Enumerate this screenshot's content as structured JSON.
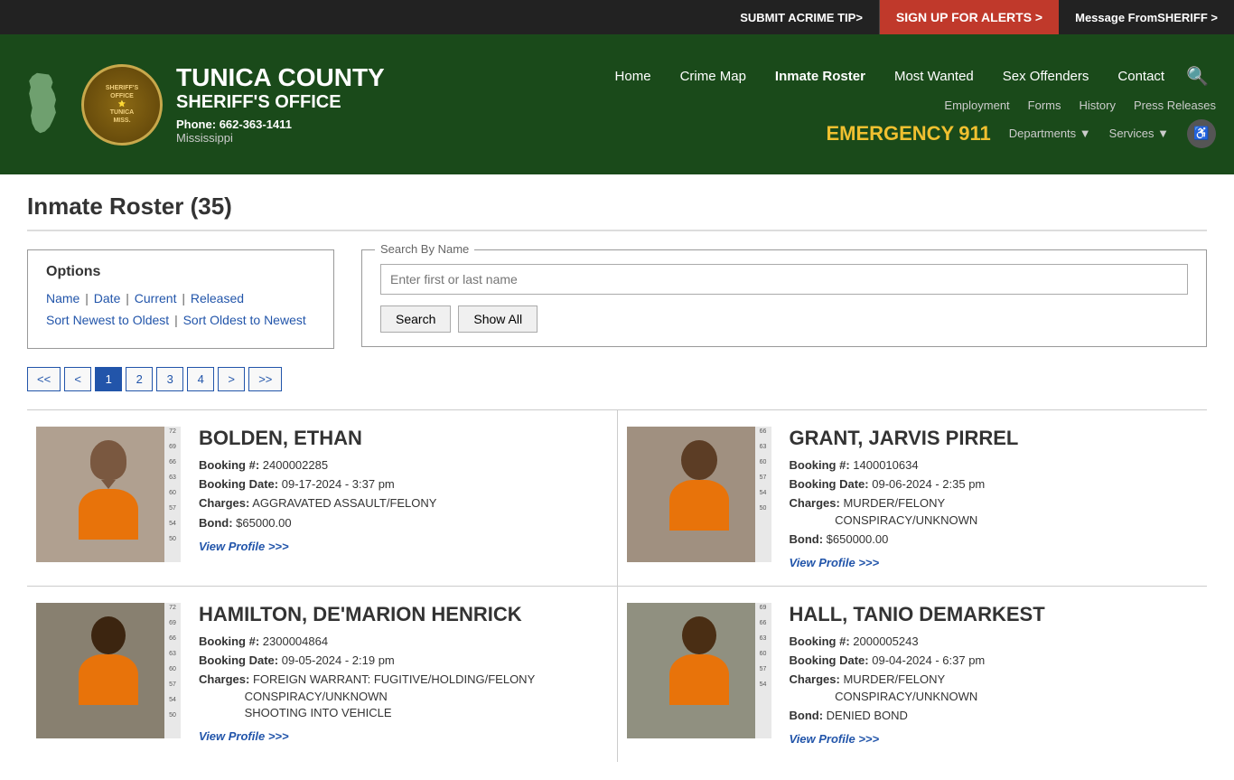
{
  "topbar": {
    "crime_tip_prefix": "SUBMIT A ",
    "crime_tip_link": "CRIME TIP",
    "crime_tip_suffix": " >",
    "alerts_label": "SIGN UP FOR ALERTS >",
    "sheriff_prefix": "Message From ",
    "sheriff_label": "SHERIFF >"
  },
  "header": {
    "county": "TUNICA COUNTY",
    "office": "SHERIFF'S OFFICE",
    "phone_label": "Phone:",
    "phone": "662-363-1411",
    "state": "Mississippi",
    "badge_line1": "SHERIFF'S OFFICE",
    "badge_line2": "MISS.",
    "nav": {
      "home": "Home",
      "crime_map": "Crime Map",
      "inmate_roster": "Inmate Roster",
      "most_wanted": "Most Wanted",
      "sex_offenders": "Sex Offenders",
      "contact": "Contact"
    },
    "secondary_nav": {
      "employment": "Employment",
      "forms": "Forms",
      "history": "History",
      "press_releases": "Press Releases"
    },
    "emergency_label": "EMERGENCY",
    "emergency_number": "911",
    "departments": "Departments",
    "services": "Services"
  },
  "page": {
    "title": "Inmate Roster (35)"
  },
  "options": {
    "title": "Options",
    "links": [
      "Name",
      "Date",
      "Current",
      "Released"
    ],
    "sort_links": [
      "Sort Newest to Oldest",
      "Sort Oldest to Newest"
    ]
  },
  "search": {
    "legend": "Search By Name",
    "placeholder": "Enter first or last name",
    "search_btn": "Search",
    "showall_btn": "Show All"
  },
  "pagination": {
    "buttons": [
      "<<",
      "<",
      "1",
      "2",
      "3",
      "4",
      ">",
      ">>"
    ],
    "active": "1"
  },
  "inmates": [
    {
      "name": "BOLDEN, ETHAN",
      "booking_num": "2400002285",
      "booking_date": "09-17-2024 - 3:37 pm",
      "charges": "AGGRAVATED ASSAULT/FELONY",
      "bond": "$65000.00",
      "view_profile": "View Profile >>>"
    },
    {
      "name": "GRANT, JARVIS PIRREL",
      "booking_num": "1400010634",
      "booking_date": "09-06-2024 - 2:35 pm",
      "charges": "MURDER/FELONY CONSPIRACY/UNKNOWN",
      "bond": "$650000.00",
      "view_profile": "View Profile >>>"
    },
    {
      "name": "HAMILTON, DE'MARION HENRICK",
      "booking_num": "2300004864",
      "booking_date": "09-05-2024 - 2:19 pm",
      "charges": "FOREIGN WARRANT: FUGITIVE/HOLDING/FELONY CONSPIRACY/UNKNOWN SHOOTING INTO VEHICLE",
      "bond": "",
      "view_profile": "View Profile >>>"
    },
    {
      "name": "HALL, TANIO DEMARKEST",
      "booking_num": "2000005243",
      "booking_date": "09-04-2024 - 6:37 pm",
      "charges": "MURDER/FELONY CONSPIRACY/UNKNOWN",
      "bond": "DENIED BOND",
      "view_profile": "View Profile >>>"
    }
  ],
  "labels": {
    "booking_num": "Booking #:",
    "booking_date": "Booking Date:",
    "charges": "Charges:",
    "bond": "Bond:"
  }
}
